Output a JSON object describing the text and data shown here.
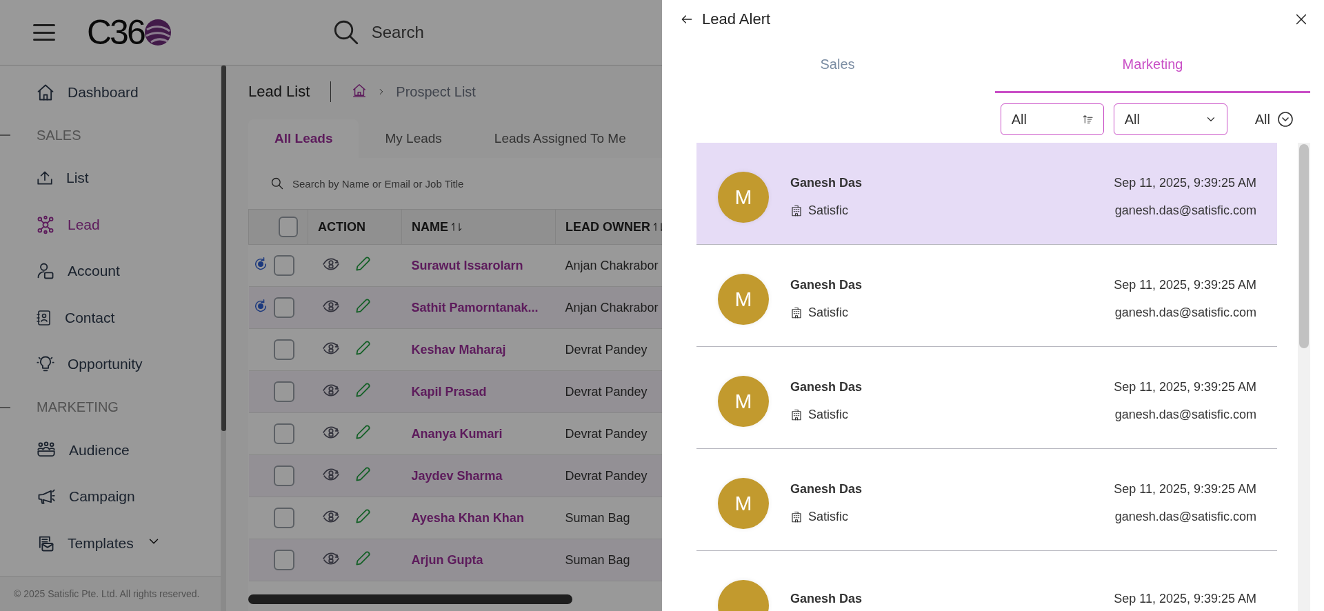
{
  "header": {
    "logo_text": "C36",
    "search": {
      "placeholder": "Search"
    }
  },
  "sidebar": {
    "items": [
      {
        "kind": "item",
        "label": "Dashboard",
        "selected": false
      },
      {
        "kind": "section",
        "label": "SALES"
      },
      {
        "kind": "item",
        "label": "List",
        "selected": false
      },
      {
        "kind": "item",
        "label": "Lead",
        "selected": true
      },
      {
        "kind": "item",
        "label": "Account",
        "selected": false
      },
      {
        "kind": "item",
        "label": "Contact",
        "selected": false
      },
      {
        "kind": "item",
        "label": "Opportunity",
        "selected": false
      },
      {
        "kind": "section",
        "label": "MARKETING"
      },
      {
        "kind": "item",
        "label": "Audience",
        "selected": false
      },
      {
        "kind": "item",
        "label": "Campaign",
        "selected": false
      },
      {
        "kind": "item",
        "label": "Templates",
        "selected": false,
        "expandable": true
      }
    ],
    "footer": "© 2025 Satisfic Pte. Ltd. All rights reserved."
  },
  "page": {
    "title": "Lead List",
    "breadcrumb": "Prospect List"
  },
  "tabs": [
    {
      "label": "All Leads",
      "selected": true
    },
    {
      "label": "My Leads",
      "selected": false
    },
    {
      "label": "Leads Assigned To Me",
      "selected": false
    }
  ],
  "table": {
    "search": {
      "placeholder": "Search by Name or Email or Job Title"
    },
    "select_all": {
      "checked": false
    },
    "columns": [
      {
        "label": "ACTION",
        "sortable": false
      },
      {
        "label": "NAME",
        "sortable": true
      },
      {
        "label": "LEAD OWNER",
        "sortable": true
      }
    ],
    "rows": [
      {
        "flagged": true,
        "checked": false,
        "name": "Surawut Issarolarn",
        "owner": "Anjan Chakrabor"
      },
      {
        "flagged": true,
        "checked": false,
        "name": "Sathit Pamorntanak...",
        "owner": "Anjan Chakrabor"
      },
      {
        "flagged": false,
        "checked": false,
        "name": "Keshav Maharaj",
        "owner": "Devrat Pandey"
      },
      {
        "flagged": false,
        "checked": false,
        "name": "Kapil Prasad",
        "owner": "Devrat Pandey"
      },
      {
        "flagged": false,
        "checked": false,
        "name": "Ananya Kumari",
        "owner": "Devrat Pandey"
      },
      {
        "flagged": false,
        "checked": false,
        "name": "Jaydev Sharma",
        "owner": "Devrat Pandey"
      },
      {
        "flagged": false,
        "checked": false,
        "name": "Ayesha Khan Khan",
        "owner": "Suman Bag"
      },
      {
        "flagged": false,
        "checked": false,
        "name": "Arjun Gupta",
        "owner": "Suman Bag"
      }
    ]
  },
  "drawer": {
    "title": "Lead Alert",
    "tabs": [
      {
        "label": "Sales",
        "selected": false
      },
      {
        "label": "Marketing",
        "selected": true
      }
    ],
    "filters": [
      {
        "kind": "sort",
        "value": "All"
      },
      {
        "kind": "select",
        "value": "All"
      },
      {
        "kind": "toggle",
        "value": "All"
      }
    ],
    "alerts": [
      {
        "selected": true,
        "initial": "M",
        "name": "Ganesh Das",
        "company": "Satisfic",
        "time": "Sep 11, 2025, 9:39:25 AM",
        "email": "ganesh.das@satisfic.com"
      },
      {
        "selected": false,
        "initial": "M",
        "name": "Ganesh Das",
        "company": "Satisfic",
        "time": "Sep 11, 2025, 9:39:25 AM",
        "email": "ganesh.das@satisfic.com"
      },
      {
        "selected": false,
        "initial": "M",
        "name": "Ganesh Das",
        "company": "Satisfic",
        "time": "Sep 11, 2025, 9:39:25 AM",
        "email": "ganesh.das@satisfic.com"
      },
      {
        "selected": false,
        "initial": "M",
        "name": "Ganesh Das",
        "company": "Satisfic",
        "time": "Sep 11, 2025, 9:39:25 AM",
        "email": "ganesh.das@satisfic.com"
      },
      {
        "selected": false,
        "name": "Ganesh Das",
        "time": "Sep 11, 2025, 9:39:25 AM"
      }
    ]
  }
}
